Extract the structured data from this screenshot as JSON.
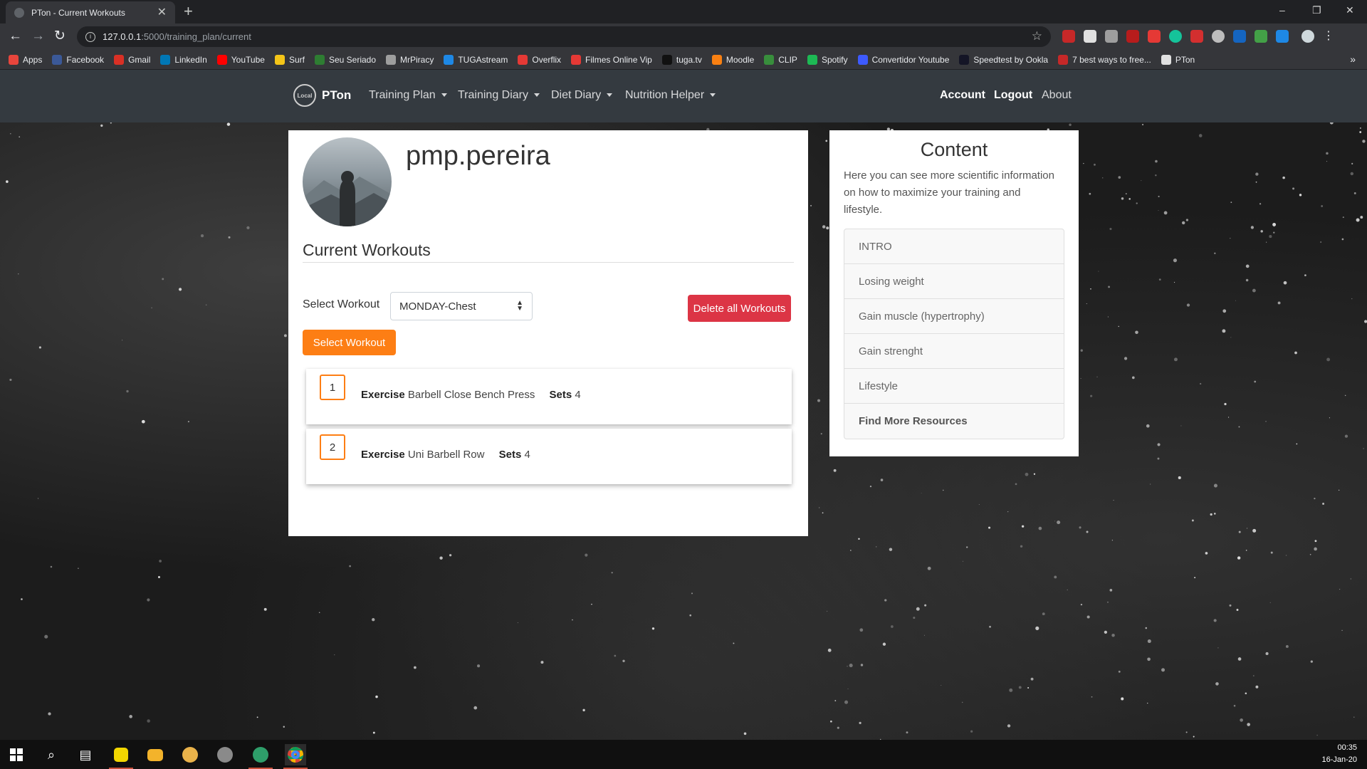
{
  "browser": {
    "tab_title": "PTon - Current Workouts",
    "tab_close": "✕",
    "new_tab": "+",
    "url_host": "127.0.0.1",
    "url_path": ":5000/training_plan/current",
    "window_controls": [
      "–",
      "❐",
      "✕"
    ],
    "bookmarks": [
      {
        "label": "Apps",
        "color": "#e8453c"
      },
      {
        "label": "Facebook",
        "color": "#3b5998"
      },
      {
        "label": "Gmail",
        "color": "#d93025"
      },
      {
        "label": "LinkedIn",
        "color": "#0077b5"
      },
      {
        "label": "YouTube",
        "color": "#ff0000"
      },
      {
        "label": "Surf",
        "color": "#f5c518"
      },
      {
        "label": "Seu Seriado",
        "color": "#2e7d32"
      },
      {
        "label": "MrPiracy",
        "color": "#9e9e9e"
      },
      {
        "label": "TUGAstream",
        "color": "#1e88e5"
      },
      {
        "label": "Overflix",
        "color": "#e53935"
      },
      {
        "label": "Filmes Online Vip",
        "color": "#e53935"
      },
      {
        "label": "tuga.tv",
        "color": "#111111"
      },
      {
        "label": "Moodle",
        "color": "#f98012"
      },
      {
        "label": "CLIP",
        "color": "#388e3c"
      },
      {
        "label": "Spotify",
        "color": "#1db954"
      },
      {
        "label": "Convertidor Youtube",
        "color": "#3d5afe"
      },
      {
        "label": "Speedtest by Ookla",
        "color": "#141526"
      },
      {
        "label": "7 best ways to free...",
        "color": "#c62828"
      },
      {
        "label": "PTon",
        "color": "#e0e0e0"
      }
    ],
    "bookmarks_more": "»"
  },
  "nav": {
    "brand": "PTon",
    "brand_logo_text": "Local",
    "menus": [
      "Training Plan",
      "Training Diary",
      "Diet Diary",
      "Nutrition Helper"
    ],
    "account": "Account",
    "logout": "Logout",
    "about": "About"
  },
  "profile": {
    "username": "pmp.pereira"
  },
  "workouts": {
    "title": "Current Workouts",
    "select_label": "Select Workout",
    "selected": "MONDAY-Chest",
    "delete_button": "Delete all Workouts",
    "select_button": "Select Workout",
    "exercise_label": "Exercise",
    "sets_label": "Sets",
    "items": [
      {
        "num": "1",
        "exercise": "Barbell Close Bench Press",
        "sets": "4"
      },
      {
        "num": "2",
        "exercise": "Uni Barbell Row",
        "sets": "4"
      }
    ]
  },
  "content": {
    "title": "Content",
    "description": "Here you can see more scientific information on how to maximize your training and lifestyle.",
    "items": [
      "INTRO",
      "Losing weight",
      "Gain muscle (hypertrophy)",
      "Gain strenght",
      "Lifestyle",
      "Find More Resources"
    ]
  },
  "taskbar": {
    "time": "00:35",
    "date": "16-Jan-20"
  },
  "colors": {
    "accent_orange": "#fd7e14",
    "danger_red": "#dc3545",
    "navbar": "#343a40"
  }
}
